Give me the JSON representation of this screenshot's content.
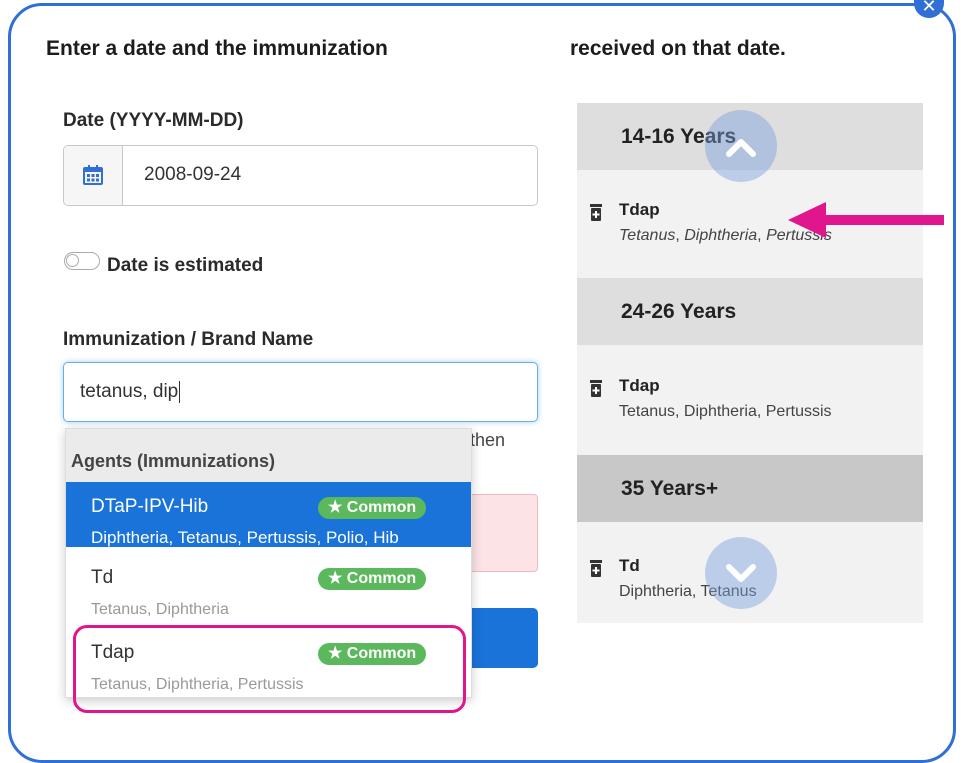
{
  "header": {
    "left": "Enter a date and the immunization",
    "right": "received on that date.",
    "close_icon": "close-icon"
  },
  "form": {
    "date_label": "Date (YYYY-MM-DD)",
    "date_value": "2008-09-24",
    "estimated_label": "Date is estimated",
    "immunization_label": "Immunization / Brand Name",
    "search_value": "tetanus, dip",
    "helper_fragment": "then"
  },
  "dropdown": {
    "header": "Agents (Immunizations)",
    "items": [
      {
        "name": "DTaP-IPV-Hib",
        "badge": "★ Common",
        "sub": "Diphtheria, Tetanus, Pertussis, Polio, Hib"
      },
      {
        "name": "Td",
        "badge": "★ Common",
        "sub": "Tetanus, Diphtheria"
      },
      {
        "name": "Tdap",
        "badge": "★ Common",
        "sub": "Tetanus, Diphtheria, Pertussis"
      }
    ]
  },
  "timeline": {
    "groups": [
      {
        "title": "14-16 Years",
        "entry": {
          "name": "Tdap",
          "desc_parts": [
            "Tetanus",
            ", ",
            "Diphtheria",
            ", ",
            "Pertussis"
          ]
        }
      },
      {
        "title": "24-26 Years",
        "entry": {
          "name": "Tdap",
          "desc": "Tetanus, Diphtheria, Pertussis"
        }
      },
      {
        "title": "35 Years+",
        "entry": {
          "name": "Td",
          "desc": "Diphtheria, Tetanus"
        }
      }
    ]
  },
  "colors": {
    "modal_border": "#2f6fd6",
    "active_item": "#1a73d9",
    "badge": "#5cb85c",
    "highlight": "#e0168c"
  }
}
